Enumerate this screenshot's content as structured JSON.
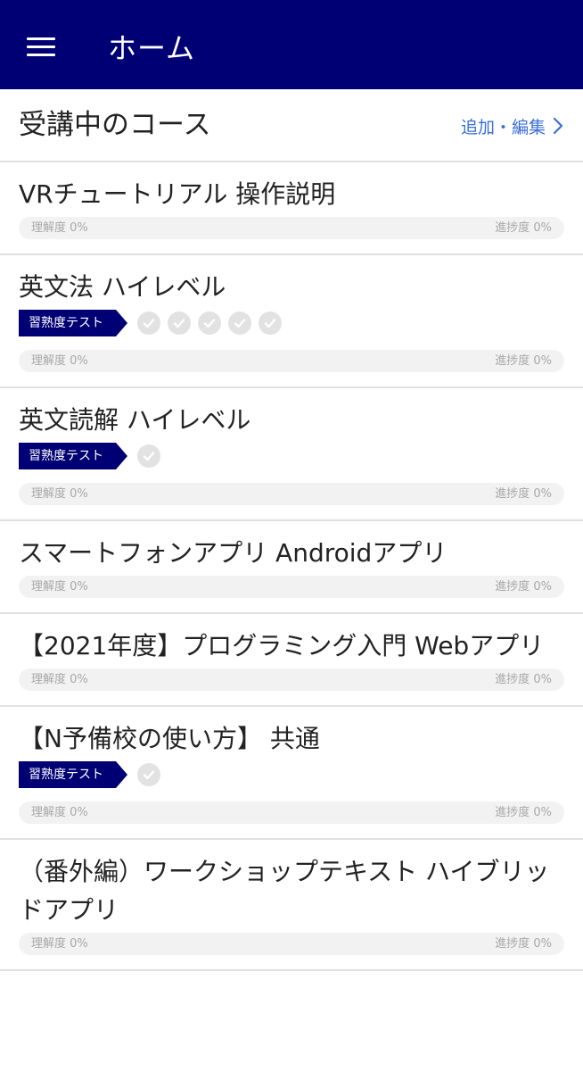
{
  "app_bar": {
    "title": "ホーム",
    "menu_icon": "hamburger-menu-icon",
    "background_color": "#000074"
  },
  "section": {
    "title": "受講中のコース",
    "edit_label": "追加・編集",
    "edit_icon": "chevron-right-icon",
    "link_color": "#3a6fd8"
  },
  "courses": [
    {
      "title": "VRチュートリアル 操作説明",
      "understanding": "理解度 0%",
      "progress": "進捗度 0%"
    },
    {
      "title": "英文法 ハイレベル",
      "test_label": "習熟度テスト",
      "checks": 5,
      "understanding": "理解度 0%",
      "progress": "進捗度 0%"
    },
    {
      "title": "英文読解 ハイレベル",
      "test_label": "習熟度テスト",
      "checks": 1,
      "understanding": "理解度 0%",
      "progress": "進捗度 0%"
    },
    {
      "title": "スマートフォンアプリ Androidアプリ",
      "understanding": "理解度 0%",
      "progress": "進捗度 0%"
    },
    {
      "title": "【2021年度】プログラミング入門 Webアプリ",
      "understanding": "理解度 0%",
      "progress": "進捗度 0%"
    },
    {
      "title": "【N予備校の使い方】 共通",
      "test_label": "習熟度テスト",
      "checks": 1,
      "understanding": "理解度 0%",
      "progress": "進捗度 0%"
    },
    {
      "title": "（番外編）ワークショップテキスト ハイブリッドアプリ",
      "understanding": "理解度 0%",
      "progress": "進捗度 0%"
    }
  ]
}
